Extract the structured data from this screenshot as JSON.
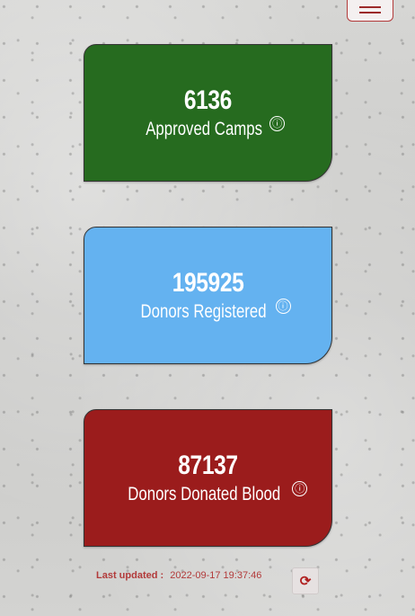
{
  "header": {
    "menu_icon": "hamburger-menu-icon"
  },
  "colors": {
    "approved": "#266b1f",
    "registered": "#64b2f0",
    "donated": "#9b1c1c",
    "accent": "#b23a3a"
  },
  "stats": [
    {
      "value": "6136",
      "label": "Approved Camps",
      "info": "ⓘ"
    },
    {
      "value": "195925",
      "label": "Donors Registered",
      "info": "ⓘ"
    },
    {
      "value": "87137",
      "label": "Donors Donated Blood",
      "info": "ⓘ"
    }
  ],
  "footer": {
    "last_updated_label": "Last updated :",
    "last_updated_value": "2022-09-17 19:37:46",
    "refresh_icon": "refresh-icon",
    "refresh_glyph": "⟳"
  }
}
